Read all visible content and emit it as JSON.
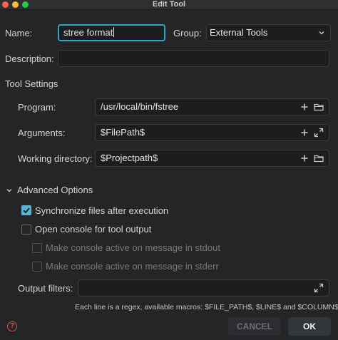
{
  "window": {
    "title": "Edit Tool"
  },
  "form": {
    "name_label": "Name:",
    "name_value": "stree format",
    "group_label": "Group:",
    "group_value": "External Tools",
    "description_label": "Description:",
    "description_value": ""
  },
  "tool_settings": {
    "title": "Tool Settings",
    "program_label": "Program:",
    "program_value": "/usr/local/bin/fstree",
    "arguments_label": "Arguments:",
    "arguments_value": "$FilePath$",
    "workdir_label": "Working directory:",
    "workdir_value": "$Projectpath$"
  },
  "advanced": {
    "title": "Advanced Options",
    "expanded": true,
    "sync_label": "Synchronize files after execution",
    "sync_checked": true,
    "console_label": "Open console for tool output",
    "console_checked": false,
    "stdout_label": "Make console active on message in stdout",
    "stderr_label": "Make console active on message in stderr",
    "output_filters_label": "Output filters:",
    "output_filters_value": "",
    "hint": "Each line is a regex, available macros: $FILE_PATH$, $LINE$ and $COLUMN$"
  },
  "footer": {
    "help_glyph": "?",
    "cancel_label": "CANCEL",
    "ok_label": "OK"
  },
  "colors": {
    "accent": "#2ea8c6",
    "checkbox": "#5ab4d8",
    "background": "#232527",
    "field": "#1c1d1f"
  },
  "icons": {
    "add": "plus-icon",
    "folder": "folder-icon",
    "expand": "expand-icon",
    "dropdown": "chevron-down-icon",
    "section": "chevron-down-icon",
    "help": "help-icon"
  }
}
